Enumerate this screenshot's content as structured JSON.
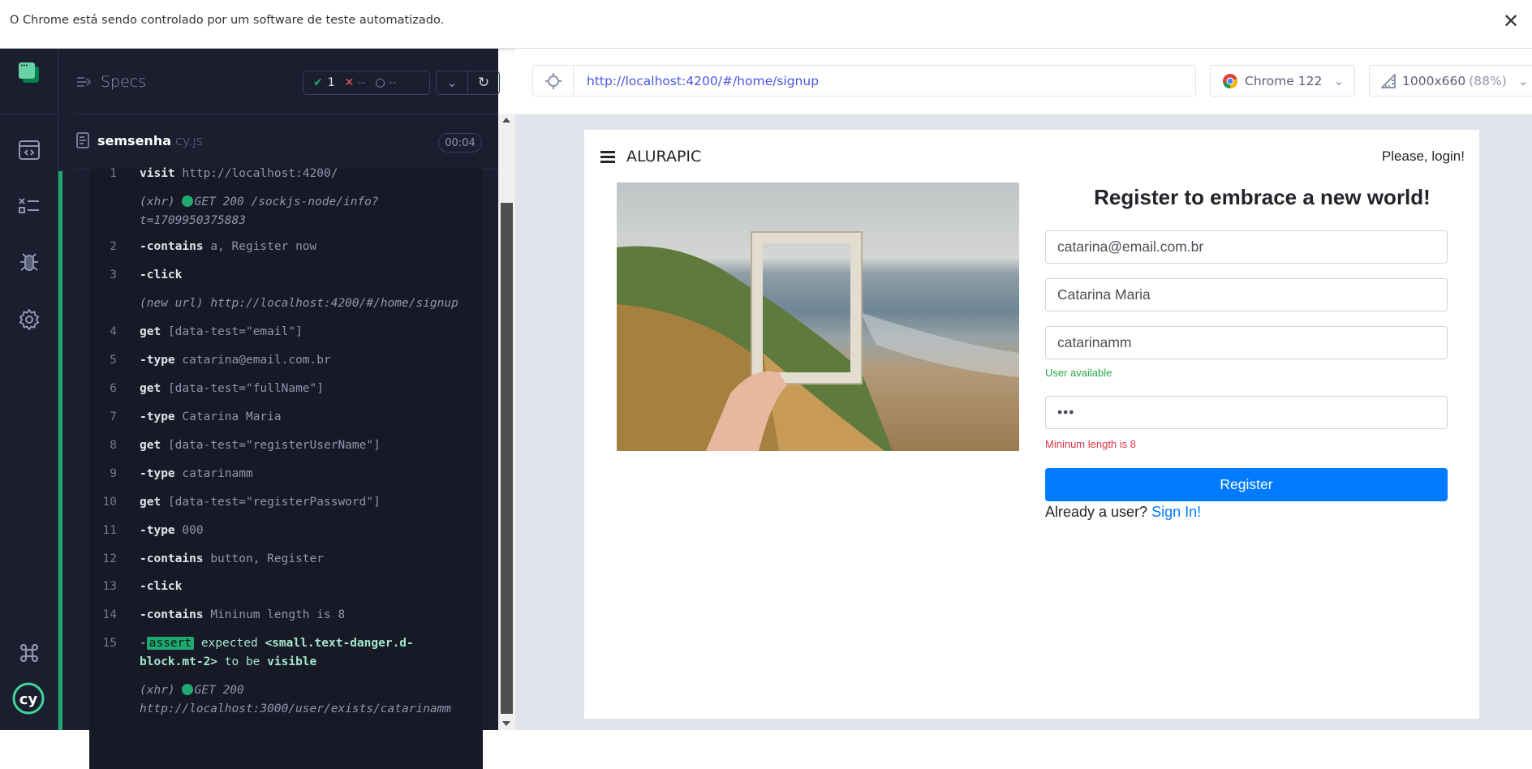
{
  "banner": {
    "text": "O Chrome está sendo controlado por um software de teste automatizado.",
    "close": "✕"
  },
  "sidebar": {
    "icons": [
      "cypress-app-icon",
      "specs-icon",
      "runs-icon",
      "debug-icon",
      "settings-icon",
      "keyboard-shortcuts-icon",
      "cypress-logo-icon"
    ]
  },
  "header": {
    "specs_label": "Specs",
    "passed": "1",
    "failed": "--",
    "pending": "--"
  },
  "spec": {
    "name": "semsenha",
    "ext": ".cy.js",
    "duration": "00:04"
  },
  "log": {
    "items": [
      {
        "num": "1",
        "kind": "cmd",
        "cmd": "visit",
        "arg": "http://localhost:4200/"
      },
      {
        "num": "",
        "kind": "xhr",
        "cmd": "(xhr)",
        "arg": "GET 200 /sockjs-node/info?",
        "arg2": "t=1709950375883"
      },
      {
        "num": "2",
        "kind": "child",
        "cmd": "contains",
        "arg": "a, Register now"
      },
      {
        "num": "3",
        "kind": "child",
        "cmd": "click",
        "arg": ""
      },
      {
        "num": "",
        "kind": "newurl",
        "cmd": "(new url)",
        "arg": "http://localhost:4200/#/home/signup"
      },
      {
        "num": "4",
        "kind": "cmd",
        "cmd": "get",
        "arg": "[data-test=\"email\"]"
      },
      {
        "num": "5",
        "kind": "child",
        "cmd": "type",
        "arg": "catarina@email.com.br"
      },
      {
        "num": "6",
        "kind": "cmd",
        "cmd": "get",
        "arg": "[data-test=\"fullName\"]"
      },
      {
        "num": "7",
        "kind": "child",
        "cmd": "type",
        "arg": "Catarina Maria"
      },
      {
        "num": "8",
        "kind": "cmd",
        "cmd": "get",
        "arg": "[data-test=\"registerUserName\"]"
      },
      {
        "num": "9",
        "kind": "child",
        "cmd": "type",
        "arg": "catarinamm"
      },
      {
        "num": "10",
        "kind": "cmd",
        "cmd": "get",
        "arg": "[data-test=\"registerPassword\"]"
      },
      {
        "num": "11",
        "kind": "child",
        "cmd": "type",
        "arg": "000"
      },
      {
        "num": "12",
        "kind": "child",
        "cmd": "contains",
        "arg": "button, Register"
      },
      {
        "num": "13",
        "kind": "child",
        "cmd": "click",
        "arg": ""
      },
      {
        "num": "14",
        "kind": "child",
        "cmd": "contains",
        "arg": "Mininum length is 8"
      },
      {
        "num": "15",
        "kind": "assert",
        "cmd": "assert",
        "arg": "expected",
        "el1": "<small.text-danger.d-",
        "el2": "block.mt-2>",
        "mid": "to be",
        "end": "visible"
      },
      {
        "num": "",
        "kind": "xhr",
        "cmd": "(xhr)",
        "arg": "GET 200",
        "arg2": "http://localhost:3000/user/exists/catarinamm"
      }
    ]
  },
  "toolbar": {
    "url": "http://localhost:4200/#/home/signup",
    "browser": "Chrome 122",
    "viewport": "1000x660",
    "zoom": "(88%)"
  },
  "app": {
    "brand": "ALURAPIC",
    "login": "Please, login!",
    "title": "Register to embrace a new world!",
    "email": "catarina@email.com.br",
    "full_name": "Catarina Maria",
    "username": "catarinamm",
    "user_hint": "User available",
    "password": "•••",
    "password_error": "Mininum length is 8",
    "register": "Register",
    "already": "Already a user?",
    "sign_in": "Sign In!"
  },
  "colors": {
    "accent": "#007bff",
    "success": "#28a745",
    "danger": "#dc3545",
    "cypress_green": "#1fa971"
  }
}
